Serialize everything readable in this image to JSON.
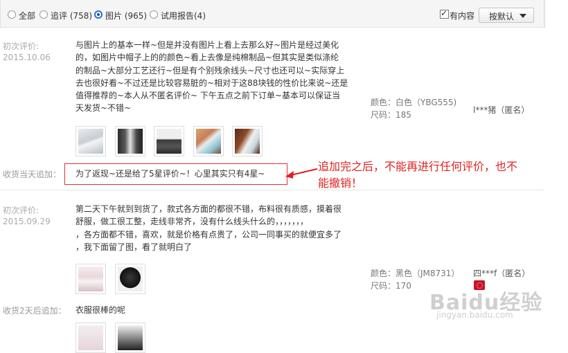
{
  "filter": {
    "all": "全部",
    "followup": "追评 (758)",
    "pictures": "图片 (965)",
    "trial": "试用报告(4)",
    "has_content": "有内容",
    "sort": "按默认"
  },
  "reviews": [
    {
      "label": "初次评价:",
      "date": "2015.10.06",
      "lines": [
        "与图片上的基本一样~但是并没有图片上看上去那么好~图片是经过美化",
        "的，如图片中帽子上的的颜色~看上去像是纯棉制品~但其实是类似涤纶",
        "的制品~大部分工艺还行~但是有个别残余线头~尺寸也还可以~实际穿上",
        "去也很好看~不过还是比较容易脏的~相对于这88块钱的性价比来说~还是",
        "值得推荐的~本人从不匿名评价~ 下午五点之前下订单~基本可以保证当",
        "天发货~不错~"
      ],
      "color": "颜色：白色（YBG555)",
      "size": "尺码：185",
      "user": "l***猪（匿名）",
      "followup_label": "收货当天追加：",
      "followup_text": "为了返现~还是给了5星评价~！心里其实只有4星~"
    },
    {
      "label": "初次评价:",
      "date": "2015.09.29",
      "lines": [
        "第二天下午就到到货了，款式各方面的都很不错，布料很有质感，摸着很",
        "舒服，做工很工整，走线非常齐，没有什么线头什么的，，，，，，，",
        "，各方面都不错，喜欢，就是价格有点贵了，公司一同事买的就便宜多了",
        "，我下面留了图，看了就明白了"
      ],
      "color": "颜色：黑色（JM8731）",
      "size": "尺码：170",
      "user": "四***f（匿名）",
      "followup_label": "收货2天后追加：",
      "followup_text": "衣服很棒的呢"
    }
  ],
  "annotation": {
    "line1": "追加完之后，不能再进行任何评价，也不",
    "line2": "能撤销！"
  },
  "watermark": {
    "brand": "Baidu经验",
    "url": "jingyan.baidu.com"
  }
}
